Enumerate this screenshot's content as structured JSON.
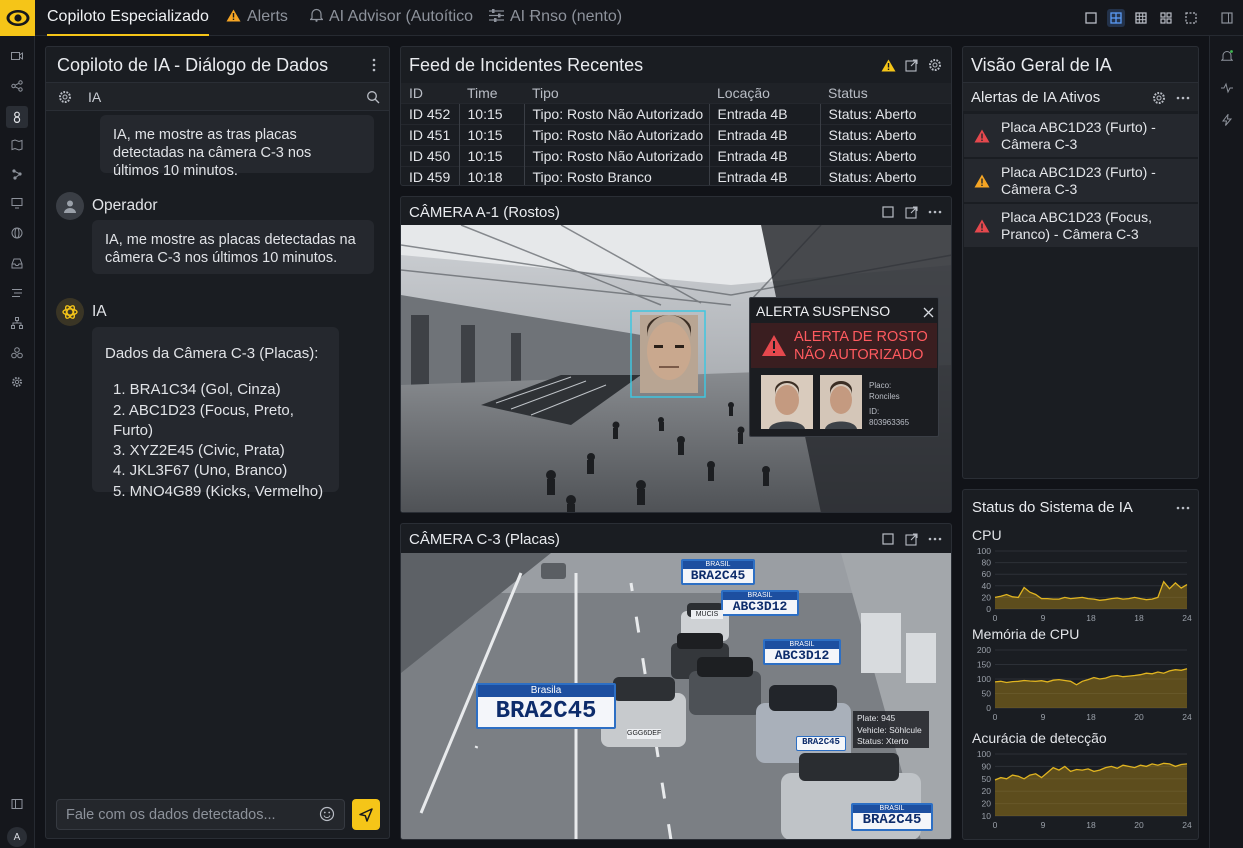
{
  "topbar": {
    "tabs": [
      {
        "label": "Copiloto Especializado"
      },
      {
        "label": "Alerts"
      },
      {
        "label": "AI Advisor (Autoítico"
      },
      {
        "label": "AI Ɍnso (nento)"
      }
    ]
  },
  "user": {
    "initial": "A"
  },
  "chat": {
    "title": "Copiloto de IA - Diálogo de Dados",
    "filter_label": "IA",
    "messages": [
      {
        "text": "IA, me mostre as tras placas detectadas na câmera C-3 nos últimos 10 minutos."
      },
      {
        "sender": "Operador",
        "text": "IA, me mostre as placas detectadas na câmera C-3 nos últimos 10 minutos."
      },
      {
        "sender": "IA",
        "heading": "Dados da Câmera C-3 (Placas):",
        "items": [
          "1. BRA1C34 (Gol, Cinza)",
          "2. ABC1D23 (Focus, Preto, Furto)",
          "3. XYZ2E45 (Civic, Prata)",
          "4. JKL3F67 (Uno, Branco)",
          "5. MNO4G89 (Kicks, Vermelho)"
        ]
      }
    ],
    "input_placeholder": "Fale com os dados detectados..."
  },
  "incidents": {
    "title": "Feed de Incidentes Recentes",
    "columns": [
      "ID",
      "Time",
      "Tipo",
      "Locação",
      "Status"
    ],
    "rows": [
      [
        "ID 452",
        "10:15",
        "Tipo: Rosto Não Autorizado",
        "Entrada 4B",
        "Status: Aberto"
      ],
      [
        "ID 451",
        "10:15",
        "Tipo: Rosto Não Autorizado",
        "Entrada 4B",
        "Status: Aberto"
      ],
      [
        "ID 450",
        "10:15",
        "Tipo: Rosto Não Autorizado",
        "Entrada 4B",
        "Status: Aberto"
      ],
      [
        "ID 459",
        "10:18",
        "Tipo: Rosto Branco",
        "Entrada 4B",
        "Status: Aberto"
      ]
    ]
  },
  "cam_a1": {
    "title": "CÂMERA A-1 (Rostos)",
    "popup": {
      "title": "ALERTA SUSPENSO",
      "headline_1": "ALERTA DE ROSTO",
      "headline_2": "NÃO AUTORIZADO",
      "meta_1": "Placo:",
      "meta_2": "Ronciles",
      "meta_3": "ID:",
      "meta_4": "803963365"
    }
  },
  "cam_c3": {
    "title": "CÂMERA C-3 (Placas)",
    "plates": [
      {
        "top": "BRASIL",
        "text": "BRA2C45"
      },
      {
        "top": "BRASIL",
        "text": "ABC3D12"
      },
      {
        "top": "BRASIL",
        "text": "ABC3D12"
      },
      {
        "top": "Brasila",
        "text": "BRA2C45"
      },
      {
        "top": "BRASIL",
        "text": "BRA2C45"
      },
      {
        "top": "BRASIL",
        "text": "BRA2C45"
      }
    ],
    "small_plates": [
      "MUCIS",
      "GGG6DEF"
    ],
    "info": {
      "line1": "Plate: 945",
      "line2": "Vehicle: Söhlcule",
      "line3": "Status: Xterto"
    }
  },
  "overview": {
    "title": "Visão Geral de IA",
    "alerts_title": "Alertas de IA Ativos",
    "alerts": [
      {
        "text": "Placa ABC1D23 (Furto) - Câmera C-3",
        "color": "#e5484d"
      },
      {
        "text": "Placa ABC1D23 (Furto) - Câmera C-3",
        "color": "#f5a524"
      },
      {
        "text": "Placa ABC1D23 (Focus, Pranco) - Câmera C-3",
        "color": "#e5484d"
      }
    ]
  },
  "status": {
    "title": "Status do Sistema de IA",
    "charts": [
      {
        "label": "CPU",
        "yticks": [
          "100",
          "80",
          "60",
          "40",
          "20",
          "0"
        ],
        "xticks": [
          "0",
          "9",
          "18",
          "18",
          "24"
        ],
        "ymax": 100,
        "values": [
          20,
          22,
          25,
          21,
          20,
          37,
          29,
          25,
          18,
          18,
          17,
          17,
          20,
          18,
          19,
          20,
          18,
          17,
          15,
          16,
          18,
          19,
          17,
          18,
          20,
          18,
          16,
          17,
          20,
          47,
          35,
          45,
          36,
          42
        ]
      },
      {
        "label": "Memória de CPU",
        "yticks": [
          "200",
          "150",
          "100",
          "50",
          "0"
        ],
        "xticks": [
          "0",
          "9",
          "18",
          "20",
          "24"
        ],
        "ymax": 200,
        "values": [
          90,
          92,
          88,
          91,
          92,
          95,
          93,
          92,
          94,
          90,
          96,
          98,
          95,
          92,
          80,
          92,
          98,
          105,
          100,
          103,
          110,
          112,
          108,
          110,
          112,
          115,
          120,
          118,
          124,
          120,
          128,
          132,
          130,
          135
        ]
      },
      {
        "label": "Acurácia de detecção",
        "yticks": [
          "100",
          "90",
          "50",
          "20",
          "20",
          "10"
        ],
        "xticks": [
          "0",
          "9",
          "18",
          "20",
          "24"
        ],
        "ymax": 100,
        "values": [
          58,
          62,
          60,
          66,
          64,
          60,
          66,
          68,
          62,
          70,
          78,
          74,
          80,
          72,
          75,
          74,
          76,
          72,
          74,
          78,
          80,
          77,
          82,
          80,
          78,
          82,
          80,
          84,
          82,
          85,
          84,
          80,
          83,
          84
        ]
      }
    ]
  }
}
